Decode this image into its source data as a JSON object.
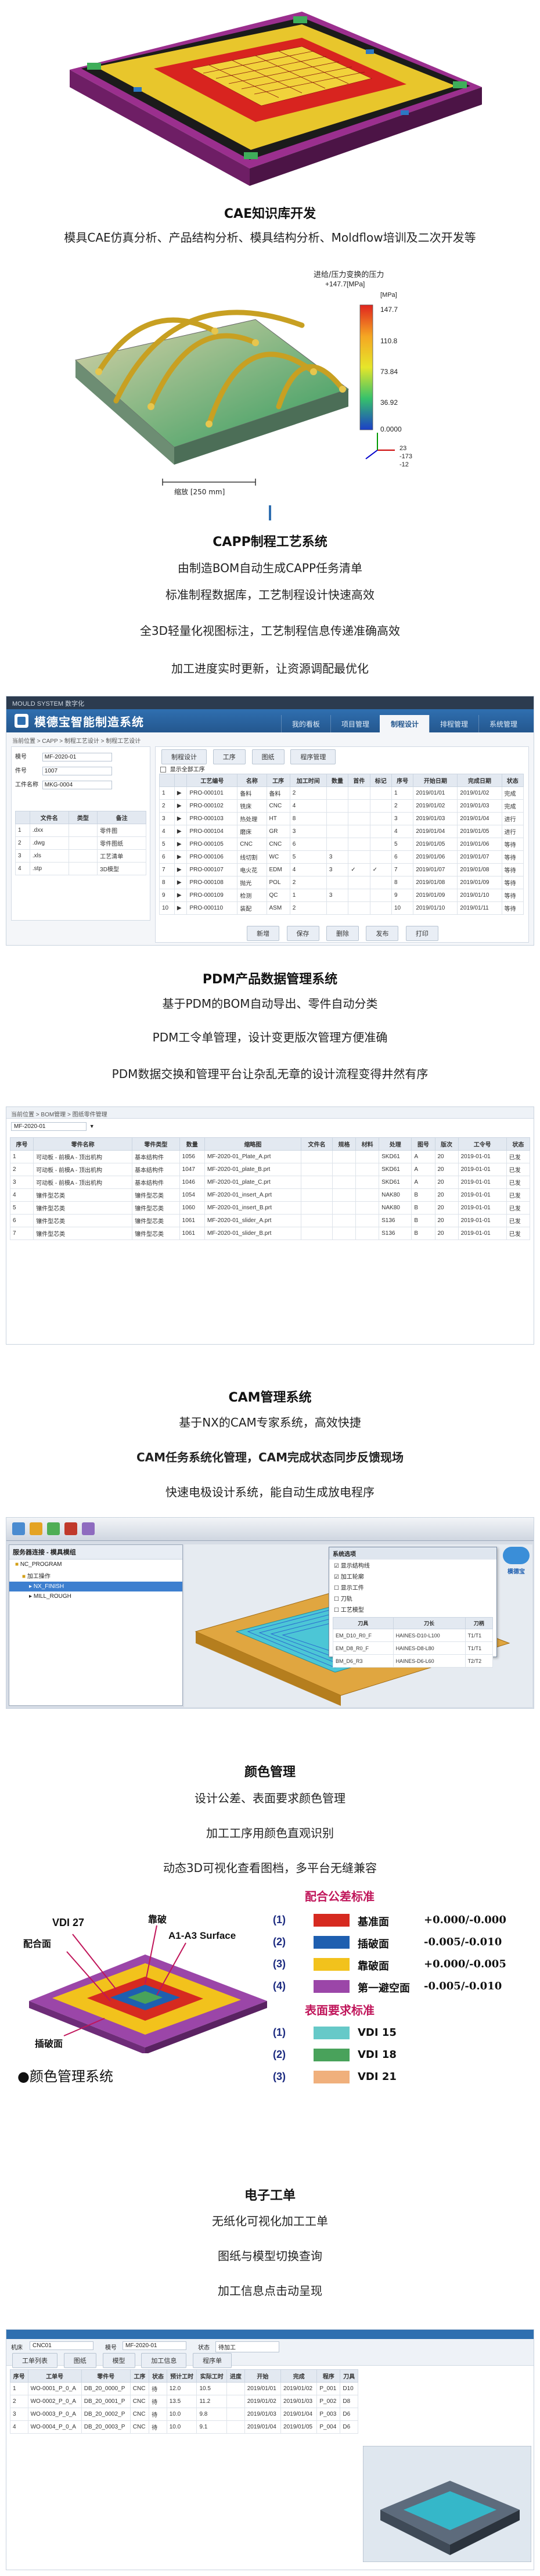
{
  "cae": {
    "title": "CAE知识库开发",
    "line1": "模具CAE仿真分析、产品结构分析、模具结构分析、Moldflow培训及二次开发等",
    "plot": {
      "legend_title": "进给/压力变换的压力",
      "legend_subtitle": "+147.7[MPa]",
      "legend_unit": "[MPa]",
      "ticks": [
        "147.7",
        "110.8",
        "73.84",
        "36.92",
        "0.0000"
      ],
      "axes_values": [
        "23",
        "-173",
        "-12"
      ],
      "scale_label": "缩放 [250 mm]"
    }
  },
  "capp": {
    "title": "CAPP制程工艺系统",
    "lines": [
      "由制造BOM自动生成CAPP任务清单",
      "标准制程数据库，工艺制程设计快速高效",
      "全3D轻量化视图标注，工艺制程信息传递准确高效",
      "加工进度实时更新，让资源调配最优化"
    ],
    "app_title": "模德宝智能制造系统",
    "top_bar": "MOULD SYSTEM  数字化",
    "tabs": [
      "我的看板",
      "项目管理",
      "制程设计",
      "排程管理",
      "系统管理"
    ],
    "breadcrumb": "当前位置 > CAPP > 制程工艺设计 > 制程工艺设计",
    "left_fields": [
      {
        "label": "模号",
        "value": "MF-2020-01"
      },
      {
        "label": "件号",
        "value": "1007"
      },
      {
        "label": "工件名称",
        "value": "MKG-0004"
      }
    ],
    "left_headers": [
      "",
      "文件名",
      "类型",
      "备注"
    ],
    "left_rows": [
      [
        "1",
        ".dxx",
        "",
        "零件图"
      ],
      [
        "2",
        ".dwg",
        "",
        "零件图纸"
      ],
      [
        "3",
        ".xls",
        "",
        "工艺清单"
      ],
      [
        "4",
        ".stp",
        "",
        "3D模型"
      ]
    ],
    "sub_tabs": [
      "制程设计",
      "工序",
      "图纸",
      "程序管理"
    ],
    "check_label": "显示全部工序",
    "headers": [
      "",
      "",
      "工艺编号",
      "名称",
      "工序",
      "加工时间",
      "数量",
      "首件",
      "标记",
      "序号",
      "开始日期",
      "完成日期",
      "状态"
    ],
    "rows": [
      [
        "1",
        "▶",
        "PRO-000101",
        "备料",
        "备料",
        "2",
        "",
        "",
        "",
        "1",
        "2019/01/01",
        "2019/01/02",
        "完成"
      ],
      [
        "2",
        "▶",
        "PRO-000102",
        "铣床",
        "CNC",
        "4",
        "",
        "",
        "",
        "2",
        "2019/01/02",
        "2019/01/03",
        "完成"
      ],
      [
        "3",
        "▶",
        "PRO-000103",
        "热处理",
        "HT",
        "8",
        "",
        "",
        "",
        "3",
        "2019/01/03",
        "2019/01/04",
        "进行"
      ],
      [
        "4",
        "▶",
        "PRO-000104",
        "磨床",
        "GR",
        "3",
        "",
        "",
        "",
        "4",
        "2019/01/04",
        "2019/01/05",
        "进行"
      ],
      [
        "5",
        "▶",
        "PRO-000105",
        "CNC",
        "CNC",
        "6",
        "",
        "",
        "",
        "5",
        "2019/01/05",
        "2019/01/06",
        "等待"
      ],
      [
        "6",
        "▶",
        "PRO-000106",
        "线切割",
        "WC",
        "5",
        "3",
        "",
        "",
        "6",
        "2019/01/06",
        "2019/01/07",
        "等待"
      ],
      [
        "7",
        "▶",
        "PRO-000107",
        "电火花",
        "EDM",
        "4",
        "3",
        "✓",
        "✓",
        "7",
        "2019/01/07",
        "2019/01/08",
        "等待"
      ],
      [
        "8",
        "▶",
        "PRO-000108",
        "抛光",
        "POL",
        "2",
        "",
        "",
        "",
        "8",
        "2019/01/08",
        "2019/01/09",
        "等待"
      ],
      [
        "9",
        "▶",
        "PRO-000109",
        "检测",
        "QC",
        "1",
        "3",
        "",
        "",
        "9",
        "2019/01/09",
        "2019/01/10",
        "等待"
      ],
      [
        "10",
        "▶",
        "PRO-000110",
        "装配",
        "ASM",
        "2",
        "",
        "",
        "",
        "10",
        "2019/01/10",
        "2019/01/11",
        "等待"
      ]
    ],
    "buttons": [
      "新增",
      "保存",
      "删除",
      "发布",
      "打印"
    ]
  },
  "pdm": {
    "title": "PDM产品数据管理系统",
    "lines": [
      "基于PDM的BOM自动导出、零件自动分类",
      "PDM工令单管理，设计变更版次管理方便准确",
      "PDM数据交换和管理平台让杂乱无章的设计流程变得井然有序"
    ],
    "breadcrumb": "当前位置 > BOM管理 > 图纸零件管理",
    "filter_value": "MF-2020-01",
    "headers": [
      "序号",
      "零件名称",
      "零件类型",
      "数量",
      "缩略图",
      "文件名",
      "规格",
      "材料",
      "处理",
      "图号",
      "版次",
      "工令号",
      "状态"
    ],
    "rows": [
      [
        "1",
        "可动板 - 前模A - 顶出机构",
        "基本结构件",
        "1056",
        "MF-2020-01_Plate_A.prt",
        "",
        "",
        "",
        "SKD61",
        "A",
        "20",
        "2019-01-01",
        "已发"
      ],
      [
        "2",
        "可动板 - 前模A - 顶出机构",
        "基本结构件",
        "1047",
        "MF-2020-01_plate_B.prt",
        "",
        "",
        "",
        "SKD61",
        "A",
        "20",
        "2019-01-01",
        "已发"
      ],
      [
        "3",
        "可动板 - 前模A - 顶出机构",
        "基本结构件",
        "1046",
        "MF-2020-01_plate_C.prt",
        "",
        "",
        "",
        "SKD61",
        "A",
        "20",
        "2019-01-01",
        "已发"
      ],
      [
        "4",
        "镶件型芯类",
        "镶件型芯类",
        "1054",
        "MF-2020-01_insert_A.prt",
        "",
        "",
        "",
        "NAK80",
        "B",
        "20",
        "2019-01-01",
        "已发"
      ],
      [
        "5",
        "镶件型芯类",
        "镶件型芯类",
        "1060",
        "MF-2020-01_insert_B.prt",
        "",
        "",
        "",
        "NAK80",
        "B",
        "20",
        "2019-01-01",
        "已发"
      ],
      [
        "6",
        "镶件型芯类",
        "镶件型芯类",
        "1061",
        "MF-2020-01_slider_A.prt",
        "",
        "",
        "",
        "S136",
        "B",
        "20",
        "2019-01-01",
        "已发"
      ],
      [
        "7",
        "镶件型芯类",
        "镶件型芯类",
        "1061",
        "MF-2020-01_slider_B.prt",
        "",
        "",
        "",
        "S136",
        "B",
        "20",
        "2019-01-01",
        "已发"
      ]
    ]
  },
  "cam": {
    "title": "CAM管理系统",
    "lines": [
      "基于NX的CAM专家系统，高效快捷",
      "CAM任务系统化管理，CAM完成状态同步反馈现场",
      "快速电极设计系统，能自动生成放电程序"
    ],
    "tree_title": "服务器连接 - 模具模组",
    "tree_items": [
      "NC_PROGRAM",
      "加工操作",
      "NX_FINISH",
      "MILL_ROUGH"
    ],
    "dialog_title": "系统选项",
    "dialog_options": [
      "显示结构线",
      "加工轮廓",
      "显示工件",
      "刀轨",
      "工艺模型"
    ],
    "dialog_headers": [
      "刀具",
      "刀长",
      "刀柄"
    ],
    "dialog_rows": [
      [
        "EM_D10_R0_F",
        "HAINES-D10-L100",
        "T1/T1"
      ],
      [
        "EM_D8_R0_F",
        "HAINES-D8-L80",
        "T1/T1"
      ],
      [
        "BM_D6_R3",
        "HAINES-D6-L60",
        "T2/T2"
      ]
    ],
    "brand": "模德宝"
  },
  "color": {
    "title": "颜色管理",
    "lines": [
      "设计公差、表面要求颜色管理",
      "加工工序用颜色直观识别",
      "动态3D可视化查看图档，多平台无缝兼容"
    ],
    "callouts": [
      "VDI 27",
      "配合面",
      "靠破",
      "A1-A3 Surface",
      "插破面"
    ],
    "footer": "●颜色管理系统",
    "fit_title": "配合公差标准",
    "fit_rows": [
      {
        "num": "(1)",
        "name": "基准面",
        "tol": "+0.000/-0.000",
        "color": "#d62a20"
      },
      {
        "num": "(2)",
        "name": "插破面",
        "tol": "-0.005/-0.010",
        "color": "#1e5fb0"
      },
      {
        "num": "(3)",
        "name": "靠破面",
        "tol": "+0.000/-0.005",
        "color": "#f2c21c"
      },
      {
        "num": "(4)",
        "name": "第一避空面",
        "tol": "-0.005/-0.010",
        "color": "#9b46a8"
      }
    ],
    "surface_title": "表面要求标准",
    "surface_rows": [
      {
        "num": "(1)",
        "name": "VDI 15",
        "color": "#66c9c8"
      },
      {
        "num": "(2)",
        "name": "VDI 18",
        "color": "#49a25b"
      },
      {
        "num": "(3)",
        "name": "VDI 21",
        "color": "#f0b07c"
      }
    ]
  },
  "ework": {
    "title": "电子工单",
    "lines": [
      "无纸化可视化加工工单",
      "图纸与模型切换查询",
      "加工信息点击动呈现"
    ],
    "filter_fields": [
      {
        "label": "机床",
        "value": "CNC01"
      },
      {
        "label": "模号",
        "value": "MF-2020-01"
      },
      {
        "label": "状态",
        "value": "待加工"
      }
    ],
    "filter_tabs": [
      "工单列表",
      "图纸",
      "模型",
      "加工信息",
      "程序单"
    ],
    "headers": [
      "序号",
      "工单号",
      "零件号",
      "工序",
      "状态",
      "预计工时",
      "实际工时",
      "进度",
      "开始",
      "完成",
      "程序",
      "刀具"
    ],
    "rows": [
      [
        "1",
        "WO-0001_P_0_A",
        "DB_20_0000_P",
        "CNC",
        "待",
        "12.0",
        "10.5",
        "",
        "2019/01/01",
        "2019/01/02",
        "P_001",
        "D10"
      ],
      [
        "2",
        "WO-0002_P_0_A",
        "DB_20_0001_P",
        "CNC",
        "待",
        "13.5",
        "11.2",
        "",
        "2019/01/02",
        "2019/01/03",
        "P_002",
        "D8"
      ],
      [
        "3",
        "WO-0003_P_0_A",
        "DB_20_0002_P",
        "CNC",
        "待",
        "10.0",
        "9.8",
        "",
        "2019/01/03",
        "2019/01/04",
        "P_003",
        "D6"
      ],
      [
        "4",
        "WO-0004_P_0_A",
        "DB_20_0003_P",
        "CNC",
        "待",
        "10.0",
        "9.1",
        "",
        "2019/01/04",
        "2019/01/05",
        "P_004",
        "D6"
      ]
    ]
  }
}
